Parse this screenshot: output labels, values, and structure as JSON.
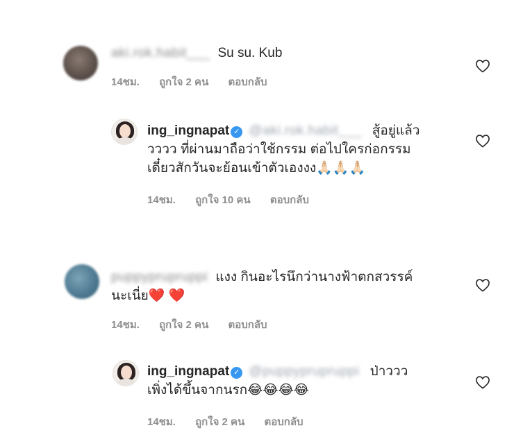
{
  "comments": [
    {
      "username": "aki.rok.habit___",
      "text": "Su su. Kub",
      "time": "14ชม.",
      "likes": "ถูกใจ 2 คน",
      "reply": "ตอบกลับ"
    },
    {
      "username": "ing_ingnapat",
      "mention": "@aki.rok.habit___",
      "line1": "สู้อยู่แล้ว",
      "line2": "วววว ที่ผ่านมาถือว่าใช้กรรม ต่อไปใครก่อกรรม",
      "line3": "เดี๋ยวสักวันจะย้อนเข้าตัวเองงง",
      "emojis": "🙏🏻🙏🏻🙏🏻",
      "time": "14ชม.",
      "likes": "ถูกใจ 10 คน",
      "reply": "ตอบกลับ"
    },
    {
      "username": "puppyprupruppi",
      "line1": "แงง กินอะไรนึกว่านางฟ้าตกสวรรค์",
      "line2": "นะเนี่ย",
      "emojis": "❤️ ❤️",
      "time": "14ชม.",
      "likes": "ถูกใจ 2 คน",
      "reply": "ตอบกลับ"
    },
    {
      "username": "ing_ingnapat",
      "mention": "@puppyprupruppi",
      "line1": "ป่าววว",
      "line2": "เพิ่งได้ขึ้นจากนรก",
      "emojis": "😂😂😂😂",
      "time": "14ชม.",
      "likes": "ถูกใจ 2 คน",
      "reply": "ตอบกลับ"
    }
  ],
  "icons": {
    "verified": "✓",
    "like": "heart-outline-icon"
  }
}
